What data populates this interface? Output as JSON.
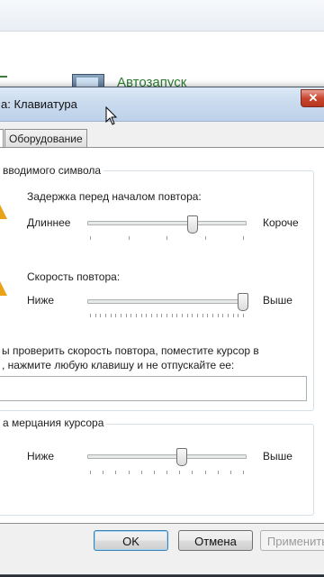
{
  "background_window": {
    "link": "Автозапуск"
  },
  "dialog": {
    "title": "а: Клавиатура",
    "close_label": "✕",
    "tabs": [
      {
        "label": "Оборудование"
      }
    ],
    "repeat_group": {
      "legend": "вводимого символа",
      "delay": {
        "label": "Задержка перед началом повтора:",
        "left": "Длиннее",
        "right": "Короче",
        "value_fraction": 0.67
      },
      "rate": {
        "label": "Скорость повтора:",
        "left": "Ниже",
        "right": "Выше",
        "value_fraction": 1.0
      },
      "test_text_line1": "ы проверить скорость повтора, поместите курсор в",
      "test_text_line2": ", нажмите любую клавишу и не отпускайте ее:",
      "test_input_value": ""
    },
    "blink_group": {
      "legend": "а мерцания курсора",
      "left": "Ниже",
      "right": "Выше",
      "value_fraction": 0.6
    },
    "buttons": {
      "ok": "OK",
      "cancel": "Отмена",
      "apply": "Применить"
    }
  }
}
